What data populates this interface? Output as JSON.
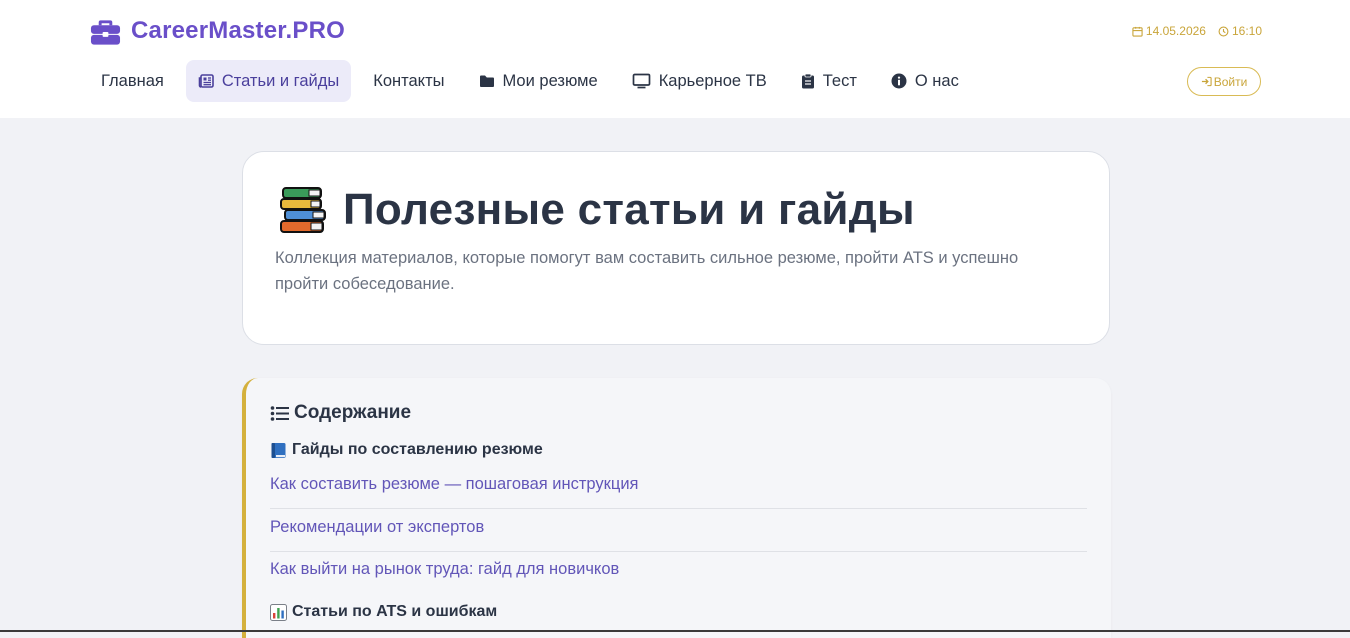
{
  "header": {
    "brand": "CareerMaster.PRO",
    "date": "14.05.2026",
    "time": "16:10",
    "login_label": "Войти"
  },
  "nav": {
    "items": [
      {
        "label": "Главная",
        "icon": ""
      },
      {
        "label": "Статьи и гайды",
        "icon": "newspaper-icon",
        "active": true
      },
      {
        "label": "Контакты",
        "icon": ""
      },
      {
        "label": "Мои резюме",
        "icon": "folder-icon"
      },
      {
        "label": "Карьерное ТВ",
        "icon": "tv-icon"
      },
      {
        "label": "Тест",
        "icon": "clipboard-icon"
      },
      {
        "label": "О нас",
        "icon": "info-icon"
      }
    ]
  },
  "hero": {
    "title": "Полезные статьи и гайды",
    "description": "Коллекция материалов, которые помогут вам составить сильное резюме, пройти ATS и успешно пройти собеседование."
  },
  "toc": {
    "heading": "Содержание",
    "sections": [
      {
        "title": "Гайды по составлению резюме",
        "icon": "blue-book-icon",
        "links": [
          "Как составить резюме — пошаговая инструкция",
          "Рекомендации от экспертов",
          "Как выйти на рынок труда: гайд для новичков"
        ]
      },
      {
        "title": "Статьи по ATS и ошибкам",
        "icon": "bar-chart-icon",
        "links": []
      }
    ]
  },
  "colors": {
    "brand": "#6a4fc9",
    "accent_gold": "#c9a53a",
    "link": "#6256b8",
    "active_nav_bg": "#ecebf9"
  }
}
